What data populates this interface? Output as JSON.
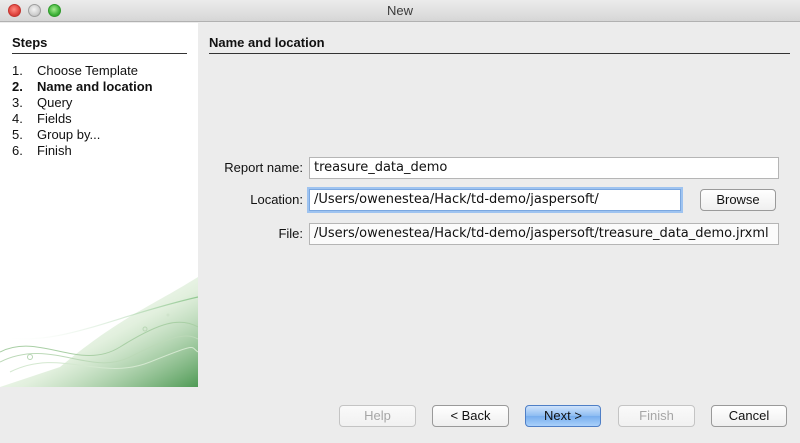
{
  "window": {
    "title": "New"
  },
  "steps": {
    "title": "Steps",
    "items": [
      {
        "num": "1.",
        "label": "Choose Template"
      },
      {
        "num": "2.",
        "label": "Name and location"
      },
      {
        "num": "3.",
        "label": "Query"
      },
      {
        "num": "4.",
        "label": "Fields"
      },
      {
        "num": "5.",
        "label": "Group by..."
      },
      {
        "num": "6.",
        "label": "Finish"
      }
    ],
    "current_index": 1
  },
  "main": {
    "title": "Name and location",
    "report_name": {
      "label": "Report name:",
      "value": "treasure_data_demo"
    },
    "location": {
      "label": "Location:",
      "value": "/Users/owenestea/Hack/td-demo/jaspersoft/"
    },
    "file": {
      "label": "File:",
      "value": "/Users/owenestea/Hack/td-demo/jaspersoft/treasure_data_demo.jrxml"
    },
    "browse_label": "Browse"
  },
  "footer": {
    "help_label": "Help",
    "back_label": "< Back",
    "next_label": "Next >",
    "finish_label": "Finish",
    "cancel_label": "Cancel"
  }
}
